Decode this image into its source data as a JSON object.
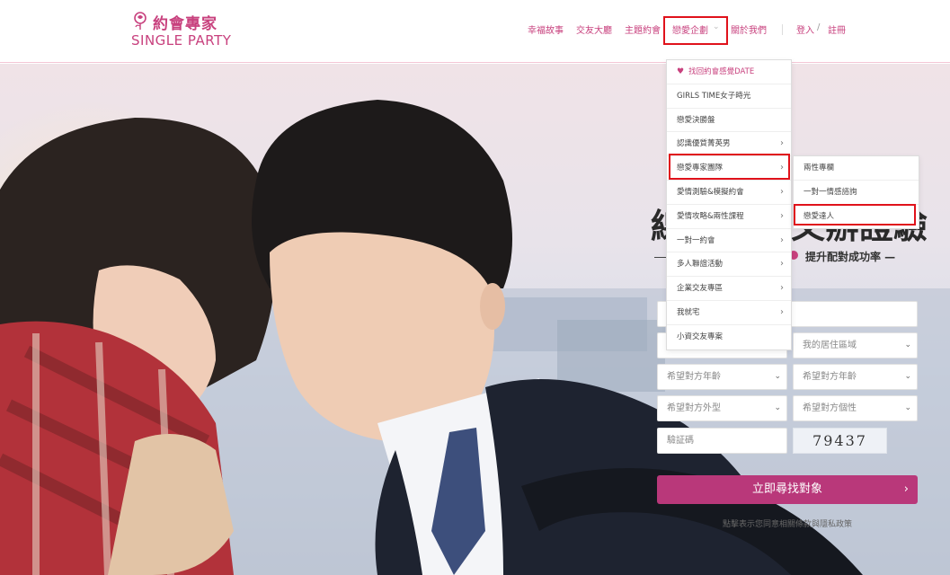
{
  "brand": {
    "name_cn": "約會專家",
    "name_en": "SINGLE PARTY",
    "color": "#c8417e"
  },
  "nav": {
    "items": [
      {
        "label": "幸福故事"
      },
      {
        "label": "交友大廳"
      },
      {
        "label": "主題約會"
      },
      {
        "label": "戀愛企劃"
      },
      {
        "label": "關於我們"
      }
    ],
    "login": "登入",
    "slash": "/",
    "register": "註冊",
    "caret_icon": "chevron-down-icon"
  },
  "dropdown": {
    "items": [
      {
        "label": "找回約會感覺DATE",
        "icon": "heart-icon",
        "has_sub": false
      },
      {
        "label": "GIRLS TIME女子時光",
        "has_sub": false
      },
      {
        "label": "戀愛決勝盤",
        "has_sub": false
      },
      {
        "label": "認識優質菁英男",
        "has_sub": true
      },
      {
        "label": "戀愛專家團隊",
        "has_sub": true
      },
      {
        "label": "愛情測驗&模擬約會",
        "has_sub": true
      },
      {
        "label": "愛情攻略&兩性課程",
        "has_sub": true
      },
      {
        "label": "一對一約會",
        "has_sub": true
      },
      {
        "label": "多人聯誼活動",
        "has_sub": true
      },
      {
        "label": "企業交友專區",
        "has_sub": true
      },
      {
        "label": "我就宅",
        "has_sub": true
      },
      {
        "label": "小資交友專案",
        "has_sub": false
      }
    ]
  },
  "submenu": {
    "items": [
      {
        "label": "兩性專欄"
      },
      {
        "label": "一對一情感諮詢"
      },
      {
        "label": "戀愛達人"
      }
    ]
  },
  "hero": {
    "title_left": "線",
    "title_right": "又辦證驗",
    "subtitle": "提升配對成功率 —"
  },
  "form": {
    "residence_placeholder": "我的居住區域",
    "age_placeholder_left": "希望對方年齡",
    "age_placeholder_right": "希望對方年齡",
    "look_placeholder": "希望對方外型",
    "personality_placeholder": "希望對方個性",
    "captcha_placeholder": "驗証碼",
    "captcha_value": "79437",
    "submit_label": "立即尋找對象",
    "submit_color": "#b9387a",
    "footnote": "點擊表示您同意相關條款與隱私政策"
  },
  "highlight_color": "#e0121b"
}
